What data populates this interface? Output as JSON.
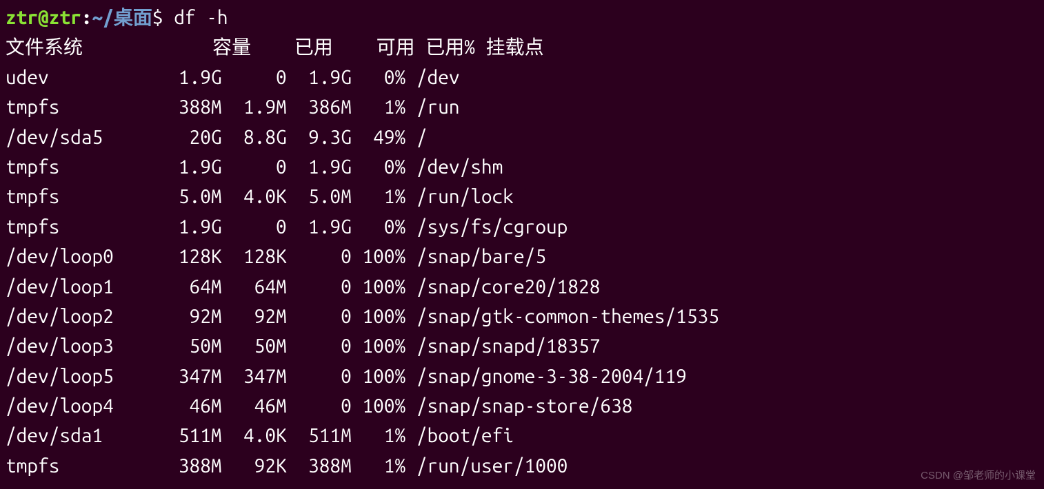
{
  "prompt": {
    "user_host": "ztr@ztr",
    "colon": ":",
    "path": "~/桌面",
    "dollar": "$ ",
    "command": "df -h"
  },
  "header": {
    "filesystem": "文件系统",
    "size": "容量",
    "used": "已用",
    "avail": "可用",
    "use_pct": "已用%",
    "mount": "挂载点"
  },
  "rows": [
    {
      "fs": "udev",
      "size": "1.9G",
      "used": "0",
      "avail": "1.9G",
      "pct": "0%",
      "mount": "/dev"
    },
    {
      "fs": "tmpfs",
      "size": "388M",
      "used": "1.9M",
      "avail": "386M",
      "pct": "1%",
      "mount": "/run"
    },
    {
      "fs": "/dev/sda5",
      "size": "20G",
      "used": "8.8G",
      "avail": "9.3G",
      "pct": "49%",
      "mount": "/"
    },
    {
      "fs": "tmpfs",
      "size": "1.9G",
      "used": "0",
      "avail": "1.9G",
      "pct": "0%",
      "mount": "/dev/shm"
    },
    {
      "fs": "tmpfs",
      "size": "5.0M",
      "used": "4.0K",
      "avail": "5.0M",
      "pct": "1%",
      "mount": "/run/lock"
    },
    {
      "fs": "tmpfs",
      "size": "1.9G",
      "used": "0",
      "avail": "1.9G",
      "pct": "0%",
      "mount": "/sys/fs/cgroup"
    },
    {
      "fs": "/dev/loop0",
      "size": "128K",
      "used": "128K",
      "avail": "0",
      "pct": "100%",
      "mount": "/snap/bare/5"
    },
    {
      "fs": "/dev/loop1",
      "size": "64M",
      "used": "64M",
      "avail": "0",
      "pct": "100%",
      "mount": "/snap/core20/1828"
    },
    {
      "fs": "/dev/loop2",
      "size": "92M",
      "used": "92M",
      "avail": "0",
      "pct": "100%",
      "mount": "/snap/gtk-common-themes/1535"
    },
    {
      "fs": "/dev/loop3",
      "size": "50M",
      "used": "50M",
      "avail": "0",
      "pct": "100%",
      "mount": "/snap/snapd/18357"
    },
    {
      "fs": "/dev/loop5",
      "size": "347M",
      "used": "347M",
      "avail": "0",
      "pct": "100%",
      "mount": "/snap/gnome-3-38-2004/119"
    },
    {
      "fs": "/dev/loop4",
      "size": "46M",
      "used": "46M",
      "avail": "0",
      "pct": "100%",
      "mount": "/snap/snap-store/638"
    },
    {
      "fs": "/dev/sda1",
      "size": "511M",
      "used": "4.0K",
      "avail": "511M",
      "pct": "1%",
      "mount": "/boot/efi"
    },
    {
      "fs": "tmpfs",
      "size": "388M",
      "used": "92K",
      "avail": "388M",
      "pct": "1%",
      "mount": "/run/user/1000"
    }
  ],
  "widths": {
    "fs": 14,
    "size": 6,
    "used": 6,
    "avail": 6,
    "pct": 5
  },
  "watermark": "CSDN @邹老师的小课堂"
}
